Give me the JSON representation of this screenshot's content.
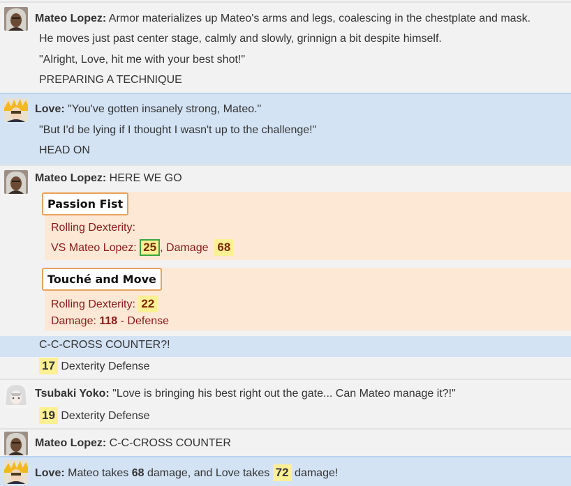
{
  "messages": {
    "m1": {
      "speaker": "Mateo Lopez:",
      "text": "Armor materializes up Mateo's arms and legs, coalescing in the chestplate and mask.",
      "line2": "He moves just past center stage, calmly and slowly, grinnign a bit despite himself.",
      "line3": "\"Alright, Love, hit me with your best shot!\"",
      "line4": "PREPARING A TECHNIQUE"
    },
    "m2": {
      "speaker": "Love:",
      "text": "\"You've gotten insanely strong, Mateo.\"",
      "line2": "\"But I'd be lying if I thought I wasn't up to the challenge!\"",
      "line3": "HEAD ON"
    },
    "m3": {
      "speaker": "Mateo Lopez:",
      "text": "HERE WE GO",
      "tech1": {
        "title": "Passion Fist",
        "roll_label": "Rolling Dexterity:",
        "vs_label": "VS Mateo Lopez:",
        "vs_value": "25",
        "damage_label": ", Damage",
        "damage_value": "68"
      },
      "tech2": {
        "title": "Touché and Move",
        "roll_label": "Rolling Dexterity:",
        "roll_value": "22",
        "damage_label": "Damage:",
        "damage_value": "118",
        "damage_suffix": "- Defense"
      },
      "cross_text": "C-C-CROSS COUNTER?!",
      "def_value": "17",
      "def_label": "Dexterity Defense"
    },
    "m4": {
      "speaker": "Tsubaki Yoko:",
      "text": "\"Love is bringing his best right out the gate... Can Mateo manage it?!\"",
      "def_value": "19",
      "def_label": "Dexterity Defense"
    },
    "m5": {
      "speaker": "Mateo Lopez:",
      "text": "C-C-CROSS COUNTER"
    },
    "m6": {
      "speaker": "Love:",
      "text_a": "Mateo takes",
      "dmg_a": "68",
      "text_b": "damage, and Love takes",
      "dmg_b": "72",
      "text_c": "damage!"
    }
  },
  "colors": {
    "blue_bg": "#d3e3f4",
    "grey_bg": "#f2f2f2",
    "roll_bg": "#fde8d5",
    "num_bg": "#fcf094",
    "title_border": "#e8a25e",
    "boxed_border": "#3aa640",
    "roll_text": "#8b1a1a"
  },
  "icons": {
    "mateo": "mateo-avatar-icon",
    "love": "love-avatar-icon",
    "tsubaki": "tsubaki-avatar-icon"
  }
}
